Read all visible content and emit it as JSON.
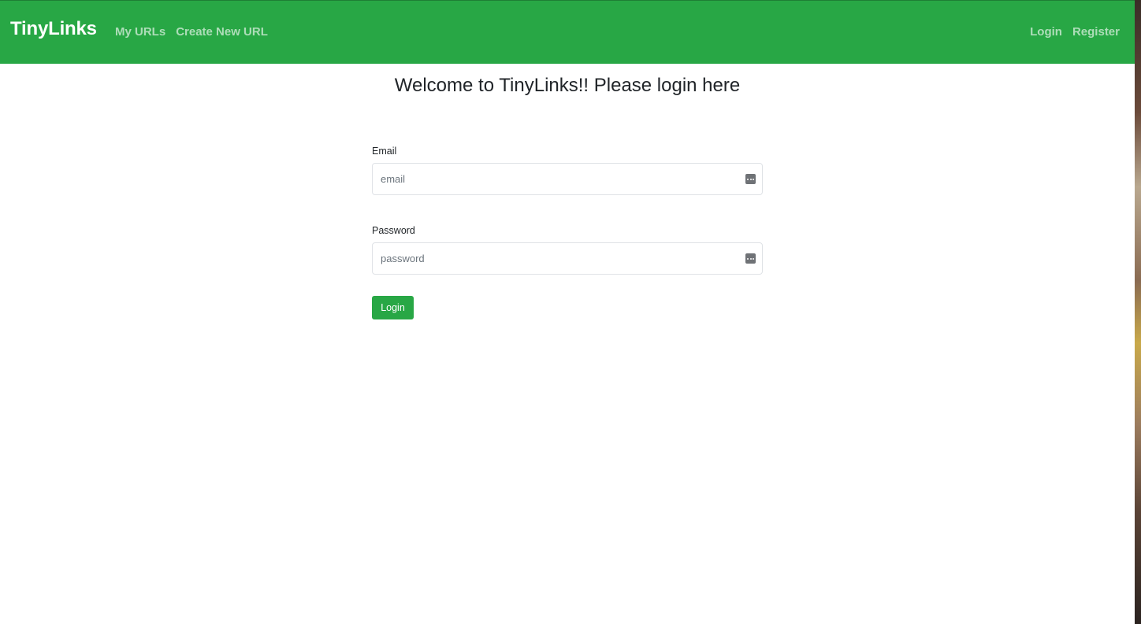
{
  "navbar": {
    "brand": "TinyLinks",
    "left_links": [
      {
        "label": "My URLs"
      },
      {
        "label": "Create New URL"
      }
    ],
    "right_links": [
      {
        "label": "Login"
      },
      {
        "label": "Register"
      }
    ],
    "background_color": "#28a745"
  },
  "main": {
    "heading": "Welcome to TinyLinks!! Please login here"
  },
  "form": {
    "email": {
      "label": "Email",
      "placeholder": "email",
      "value": "",
      "icon": "password-manager-icon"
    },
    "password": {
      "label": "Password",
      "placeholder": "password",
      "value": "",
      "icon": "password-manager-icon"
    },
    "submit_label": "Login",
    "button_color": "#28a745"
  }
}
